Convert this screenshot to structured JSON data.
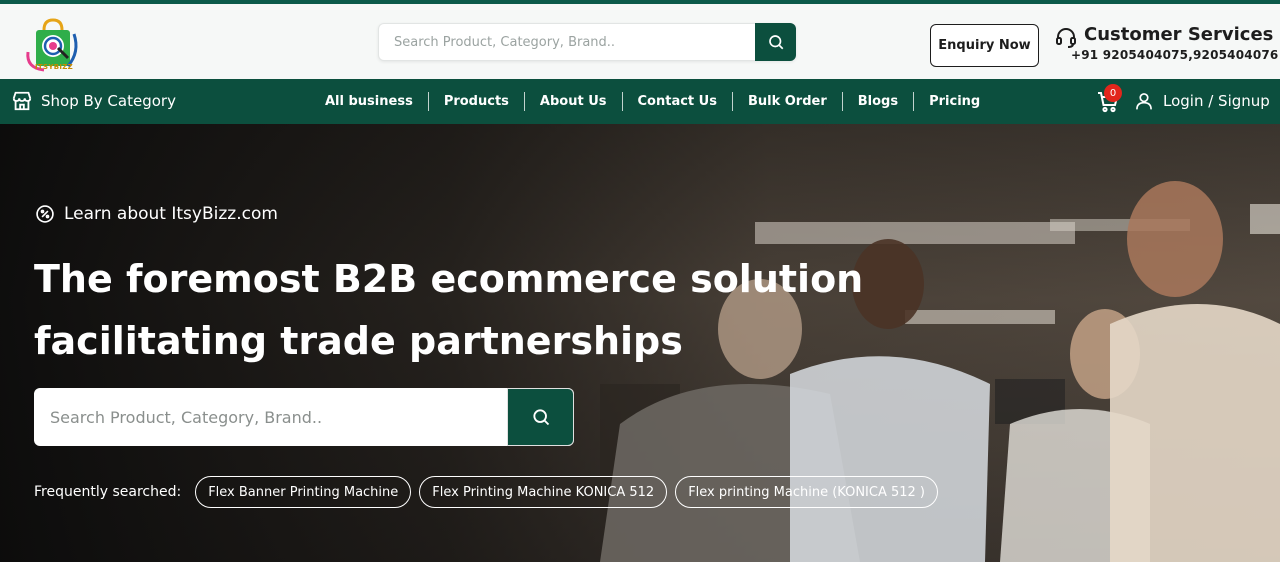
{
  "brand": {
    "logo_text": "ITSYBIZZ",
    "colors": {
      "primary": "#0c4f3e",
      "badge": "#e2261c"
    }
  },
  "header": {
    "search": {
      "placeholder": "Search Product, Category, Brand.."
    },
    "enquiry_label": "Enquiry Now",
    "customer_services": {
      "title": "Customer Services",
      "phone": "+91 9205404075,9205404076",
      "icon": "headset-icon"
    }
  },
  "nav": {
    "shop_by_category": "Shop By Category",
    "links": [
      "All business",
      "Products",
      "About Us",
      "Contact Us",
      "Bulk Order",
      "Blogs",
      "Pricing"
    ],
    "cart_count": "0",
    "login_label": "Login / Signup"
  },
  "hero": {
    "learn_label": "Learn about ItsyBizz.com",
    "headline_line1": "The foremost B2B ecommerce solution",
    "headline_line2": "facilitating trade partnerships",
    "search": {
      "placeholder": "Search Product, Category, Brand.."
    },
    "frequently_label": "Frequently searched:",
    "chips": [
      "Flex Banner Printing Machine",
      "Flex Printing Machine KONICA 512",
      "Flex printing Machine (KONICA 512 )"
    ]
  }
}
